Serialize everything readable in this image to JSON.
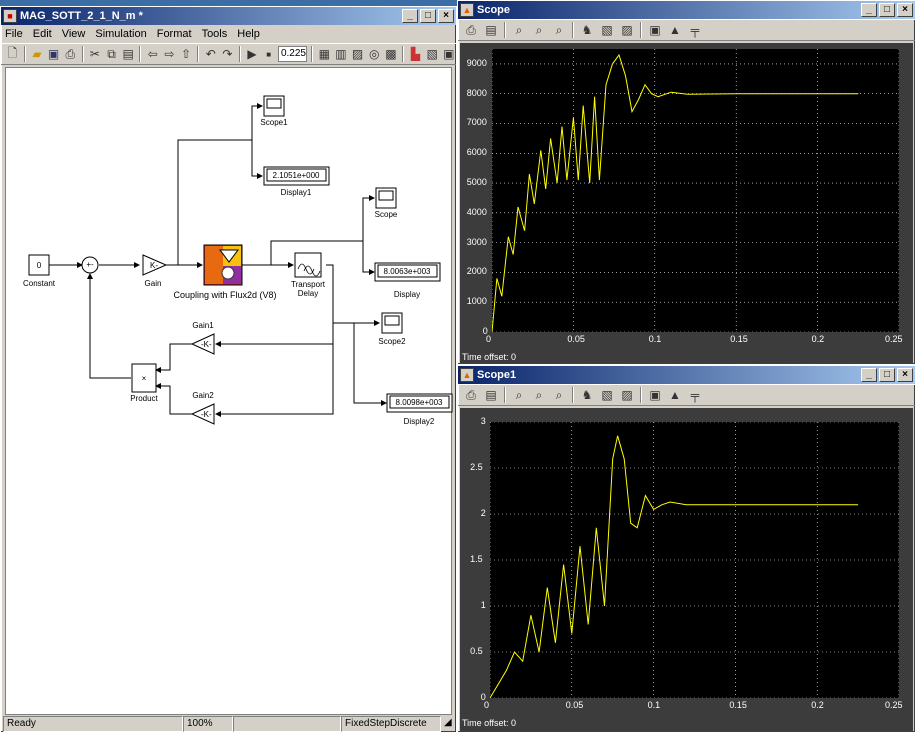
{
  "simulink": {
    "title": "MAG_SOTT_2_1_N_m *",
    "menu": [
      "File",
      "Edit",
      "View",
      "Simulation",
      "Format",
      "Tools",
      "Help"
    ],
    "stop_time": "0.225",
    "status": {
      "ready": "Ready",
      "zoom": "100%",
      "solver": "FixedStepDiscrete"
    },
    "blocks": {
      "constant_value": "0",
      "constant_label": "Constant",
      "gain_label": "Gain",
      "gain_symbol": "K-",
      "flux_label": "Coupling with Flux2d (V8)",
      "delay_label_1": "Transport",
      "delay_label_2": "Delay",
      "scope1_label": "Scope1",
      "display1_value": "2.1051e+000",
      "display1_label": "Display1",
      "scope_label": "Scope",
      "display_value": "8.0063e+003",
      "display_label": "Display",
      "scope2_label": "Scope2",
      "display2_value": "8.0098e+003",
      "display2_label": "Display2",
      "gain1_label": "Gain1",
      "gain1_symbol": "-K-",
      "gain2_label": "Gain2",
      "gain2_symbol": "-K-",
      "product_symbol": "×",
      "product_label": "Product"
    }
  },
  "scope_top": {
    "title": "Scope",
    "time_offset": "Time offset:  0",
    "y_ticks": [
      "9000",
      "8000",
      "7000",
      "6000",
      "5000",
      "4000",
      "3000",
      "2000",
      "1000",
      "0"
    ],
    "x_ticks": [
      "0",
      "0.05",
      "0.1",
      "0.15",
      "0.2",
      "0.25"
    ]
  },
  "scope_bottom": {
    "title": "Scope1",
    "time_offset": "Time offset:  0",
    "y_ticks": [
      "3",
      "2.5",
      "2",
      "1.5",
      "1",
      "0.5",
      "0"
    ],
    "x_ticks": [
      "0",
      "0.05",
      "0.1",
      "0.15",
      "0.2",
      "0.25"
    ]
  },
  "chart_data": [
    {
      "type": "line",
      "xlim": [
        0,
        0.25
      ],
      "ylim": [
        0,
        9500
      ],
      "grid": true,
      "series": [
        {
          "color": "#ffff00",
          "x": [
            0,
            0.003,
            0.006,
            0.01,
            0.013,
            0.016,
            0.02,
            0.023,
            0.026,
            0.03,
            0.033,
            0.036,
            0.04,
            0.043,
            0.046,
            0.05,
            0.053,
            0.056,
            0.06,
            0.063,
            0.066,
            0.07,
            0.074,
            0.078,
            0.082,
            0.086,
            0.09,
            0.094,
            0.098,
            0.102,
            0.11,
            0.12,
            0.15,
            0.2,
            0.225
          ],
          "y": [
            0,
            1800,
            1200,
            3200,
            2600,
            4200,
            3400,
            5300,
            4300,
            6100,
            4800,
            6500,
            5000,
            6900,
            5100,
            7200,
            5100,
            7600,
            5000,
            7900,
            5100,
            8300,
            9000,
            9300,
            8600,
            7400,
            7800,
            8300,
            8000,
            7900,
            8050,
            7980,
            8000,
            8000,
            8000
          ]
        }
      ]
    },
    {
      "type": "line",
      "xlim": [
        0,
        0.25
      ],
      "ylim": [
        0,
        3
      ],
      "grid": true,
      "series": [
        {
          "color": "#ffff00",
          "x": [
            0,
            0.005,
            0.01,
            0.015,
            0.02,
            0.025,
            0.03,
            0.035,
            0.04,
            0.045,
            0.05,
            0.055,
            0.06,
            0.065,
            0.07,
            0.075,
            0.078,
            0.082,
            0.086,
            0.09,
            0.095,
            0.1,
            0.105,
            0.11,
            0.12,
            0.15,
            0.2,
            0.225
          ],
          "y": [
            0,
            0.15,
            0.3,
            0.5,
            0.4,
            0.9,
            0.5,
            1.2,
            0.6,
            1.45,
            0.7,
            1.65,
            0.8,
            1.85,
            1.0,
            2.6,
            2.85,
            2.6,
            1.9,
            1.85,
            2.2,
            2.05,
            2.1,
            2.13,
            2.1,
            2.1,
            2.1,
            2.1
          ]
        }
      ]
    }
  ]
}
